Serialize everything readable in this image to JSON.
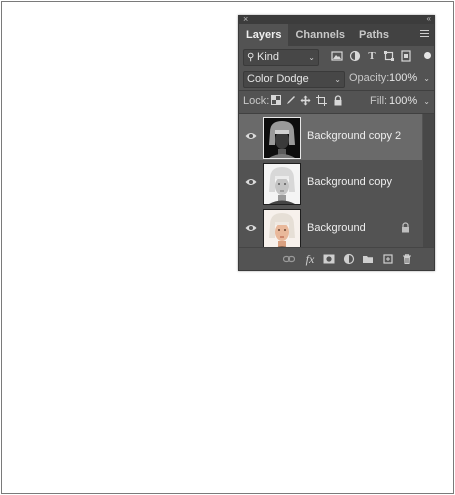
{
  "panel": {
    "close_glyph": "×",
    "collapse_glyph": "«",
    "tabs": [
      {
        "label": "Layers",
        "active": true
      },
      {
        "label": "Channels",
        "active": false
      },
      {
        "label": "Paths",
        "active": false
      }
    ],
    "filter": {
      "kind_label": "Kind",
      "icons": [
        "image-filter-icon",
        "adjustment-filter-icon",
        "type-filter-icon",
        "shape-filter-icon",
        "smart-object-filter-icon"
      ],
      "toggle_on": true
    },
    "blend": {
      "mode": "Color Dodge",
      "opacity_label": "Opacity:",
      "opacity_value": "100%"
    },
    "lock": {
      "label": "Lock:",
      "icons": [
        "lock-transparent-icon",
        "lock-pixels-icon",
        "lock-position-icon",
        "lock-artboard-icon",
        "lock-all-icon"
      ],
      "fill_label": "Fill:",
      "fill_value": "100%"
    },
    "layers": [
      {
        "name": "Background copy 2",
        "selected": true,
        "visible": true,
        "locked": false,
        "thumbnail": "dark-portrait-thumbnail"
      },
      {
        "name": "Background copy",
        "selected": false,
        "visible": true,
        "locked": false,
        "thumbnail": "grayscale-portrait-thumbnail"
      },
      {
        "name": "Background",
        "selected": false,
        "visible": true,
        "locked": true,
        "thumbnail": "color-portrait-thumbnail"
      }
    ],
    "bottom_icons": [
      "link-layers-icon",
      "fx-icon",
      "add-mask-icon",
      "new-adjustment-icon",
      "new-group-icon",
      "new-layer-icon",
      "delete-layer-icon"
    ],
    "fx_label": "fx"
  },
  "colors": {
    "panel_bg": "#535353",
    "tab_bar_bg": "#424242",
    "selected_layer": "#6a6a6a",
    "text": "#eeeeee"
  }
}
